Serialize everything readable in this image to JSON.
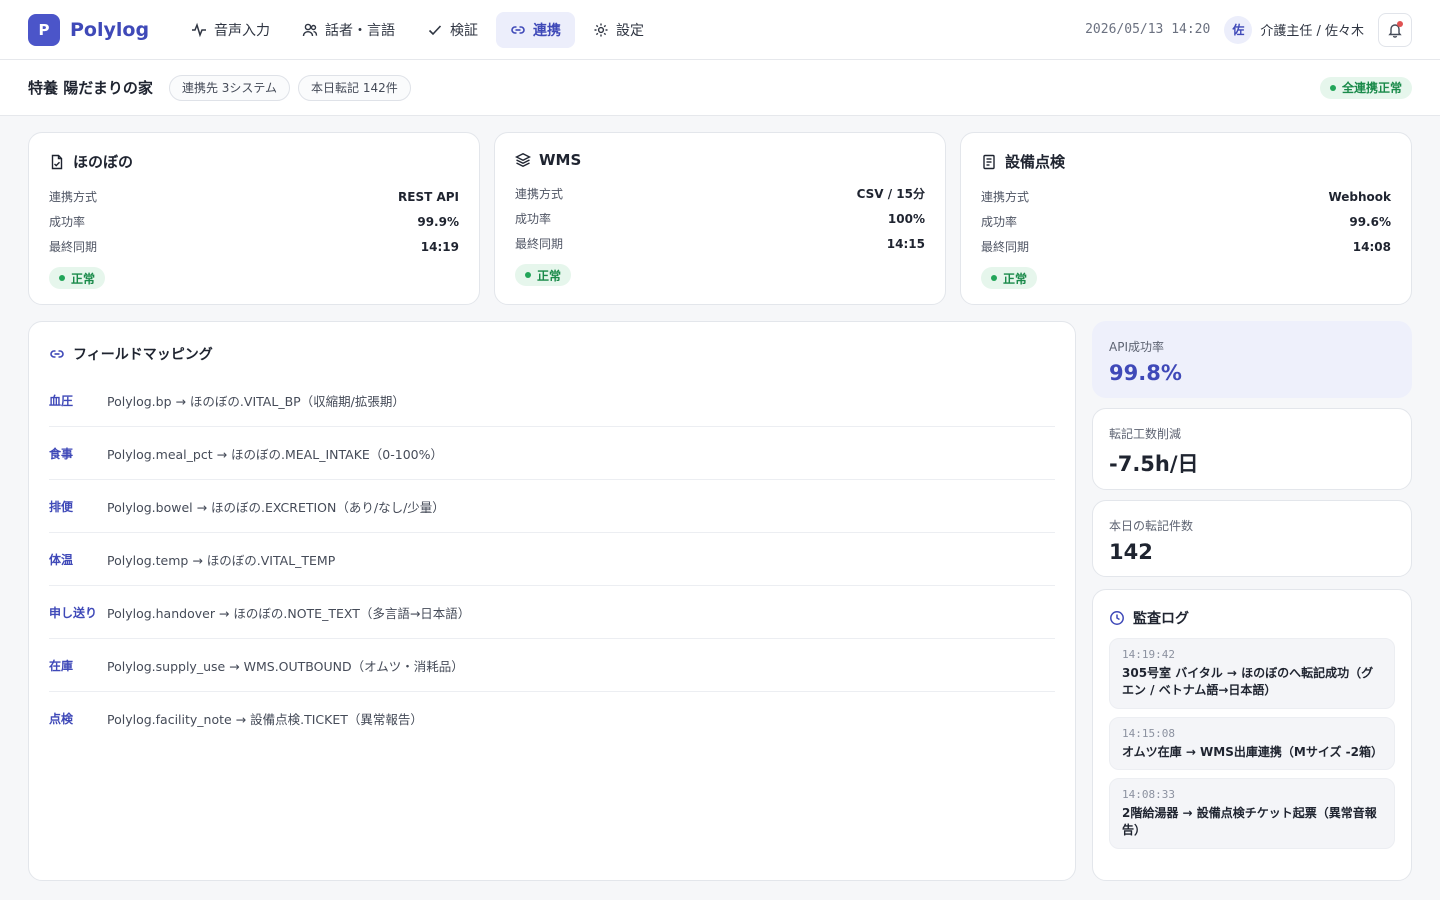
{
  "brand": {
    "initial": "P",
    "name": "Polylog"
  },
  "nav": [
    {
      "label": "音声入力",
      "icon": "activity-icon",
      "active": false
    },
    {
      "label": "話者・言語",
      "icon": "users-icon",
      "active": false
    },
    {
      "label": "検証",
      "icon": "check-icon",
      "active": false
    },
    {
      "label": "連携",
      "icon": "link-icon",
      "active": true
    },
    {
      "label": "設定",
      "icon": "gear-icon",
      "active": false
    }
  ],
  "header": {
    "datetime": "2026/05/13 14:20",
    "avatar_initial": "佐",
    "user": "介護主任 / 佐々木",
    "bell_icon": "bell-icon"
  },
  "subheader": {
    "facility": "特養 陽だまりの家",
    "chips": [
      "連携先 3システム",
      "本日転記 142件"
    ],
    "overall_status": "全連携正常"
  },
  "systems": [
    {
      "name": "ほのぼの",
      "icon": "document-icon",
      "rows": [
        {
          "label": "連携方式",
          "value": "REST API"
        },
        {
          "label": "成功率",
          "value": "99.9%"
        },
        {
          "label": "最終同期",
          "value": "14:19"
        }
      ],
      "status": "正常"
    },
    {
      "name": "WMS",
      "icon": "layers-icon",
      "rows": [
        {
          "label": "連携方式",
          "value": "CSV / 15分"
        },
        {
          "label": "成功率",
          "value": "100%"
        },
        {
          "label": "最終同期",
          "value": "14:15"
        }
      ],
      "status": "正常"
    },
    {
      "name": "設備点検",
      "icon": "clipboard-icon",
      "rows": [
        {
          "label": "連携方式",
          "value": "Webhook"
        },
        {
          "label": "成功率",
          "value": "99.6%"
        },
        {
          "label": "最終同期",
          "value": "14:08"
        }
      ],
      "status": "正常"
    }
  ],
  "mapping": {
    "title": "フィールドマッピング",
    "rows": [
      {
        "key": "血圧",
        "value": "Polylog.bp → ほのぼの.VITAL_BP（収縮期/拡張期）"
      },
      {
        "key": "食事",
        "value": "Polylog.meal_pct → ほのぼの.MEAL_INTAKE（0-100%）"
      },
      {
        "key": "排便",
        "value": "Polylog.bowel → ほのぼの.EXCRETION（あり/なし/少量）"
      },
      {
        "key": "体温",
        "value": "Polylog.temp → ほのぼの.VITAL_TEMP"
      },
      {
        "key": "申し送り",
        "value": "Polylog.handover → ほのぼの.NOTE_TEXT（多言語→日本語）"
      },
      {
        "key": "在庫",
        "value": "Polylog.supply_use → WMS.OUTBOUND（オムツ・消耗品）"
      },
      {
        "key": "点検",
        "value": "Polylog.facility_note → 設備点検.TICKET（異常報告）"
      }
    ]
  },
  "kpis": [
    {
      "label": "API成功率",
      "value": "99.8%",
      "accent": true
    },
    {
      "label": "転記工数削減",
      "value": "-7.5h/日",
      "accent": false
    },
    {
      "label": "本日の転記件数",
      "value": "142",
      "accent": false
    }
  ],
  "audit": {
    "title": "監査ログ",
    "logs": [
      {
        "time": "14:19:42",
        "text": "305号室 バイタル → ほのぼのへ転記成功（グエン / ベトナム語→日本語）"
      },
      {
        "time": "14:15:08",
        "text": "オムツ在庫 → WMS出庫連携（Mサイズ -2箱）"
      },
      {
        "time": "14:08:33",
        "text": "2階給湯器 → 設備点検チケット起票（異常音報告）"
      }
    ]
  },
  "colors": {
    "accent": "#3f49b8",
    "ok": "#1a8a4a",
    "ok_bg": "#e6f6ec"
  }
}
